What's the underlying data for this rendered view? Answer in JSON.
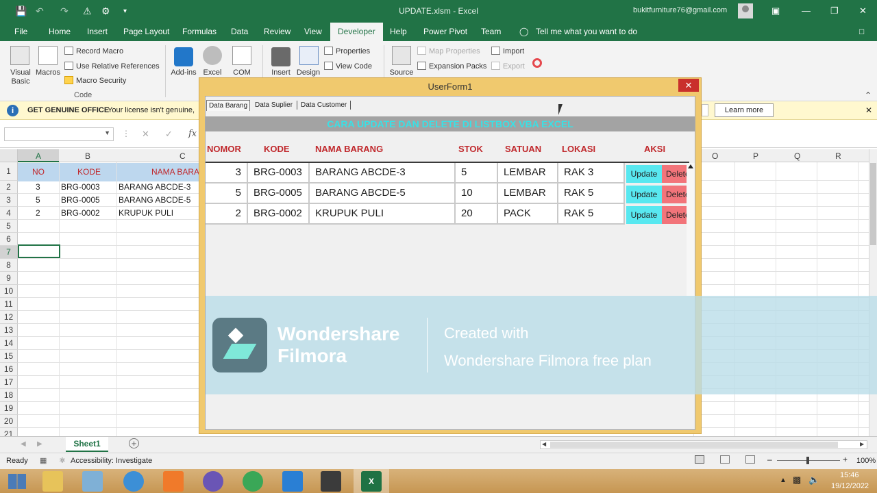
{
  "window": {
    "title": "UPDATE.xlsm  -  Excel",
    "account": "bukitfurniture76@gmail.com"
  },
  "tabs": [
    "File",
    "Home",
    "Insert",
    "Page Layout",
    "Formulas",
    "Data",
    "Review",
    "View",
    "Developer",
    "Help",
    "Power Pivot",
    "Team"
  ],
  "active_tab": "Developer",
  "tell_me": "Tell me what you want to do",
  "ribbon": {
    "visual_basic": "Visual Basic",
    "macros": "Macros",
    "record_macro": "Record Macro",
    "relative_refs": "Use Relative References",
    "macro_security": "Macro Security",
    "code_group": "Code",
    "addins": "Add-ins",
    "excel": "Excel",
    "com": "COM",
    "insert": "Insert",
    "design": "Design",
    "properties": "Properties",
    "view_code": "View Code",
    "source": "Source",
    "map_properties": "Map Properties",
    "expansion_packs": "Expansion Packs",
    "import": "Import",
    "export": "Export"
  },
  "license_bar": {
    "title": "GET GENUINE OFFICE",
    "message": "Your license isn't genuine,",
    "learn_more": "Learn more"
  },
  "grid": {
    "columns_left": [
      "A",
      "B",
      "C"
    ],
    "columns_right": [
      "O",
      "P",
      "Q",
      "R"
    ],
    "rows": [
      "1",
      "2",
      "3",
      "4",
      "5",
      "6",
      "7",
      "8",
      "9",
      "10",
      "11",
      "12",
      "13",
      "14",
      "15",
      "16",
      "17",
      "18",
      "19",
      "20",
      "21"
    ],
    "header_row": [
      "NO",
      "KODE",
      "NAMA BARA"
    ],
    "data": [
      [
        "3",
        "BRG-0003",
        "BARANG ABCDE-3"
      ],
      [
        "5",
        "BRG-0005",
        "BARANG ABCDE-5"
      ],
      [
        "2",
        "BRG-0002",
        "KRUPUK PULI"
      ]
    ]
  },
  "sheet_tab": "Sheet1",
  "status": {
    "ready": "Ready",
    "accessibility": "Accessibility: Investigate",
    "zoom": "100%"
  },
  "clock": {
    "time": "15:46",
    "date": "19/12/2022"
  },
  "userform": {
    "caption": "UserForm1",
    "tabs": [
      "Data Barang",
      "Data Suplier",
      "Data Customer"
    ],
    "banner": "CARA UPDATE DAN DELETE DI LISTBOX VBA EXCEL",
    "headers": [
      "NOMOR",
      "KODE",
      "NAMA BARANG",
      "STOK",
      "SATUAN",
      "LOKASI",
      "AKSI"
    ],
    "rows": [
      {
        "nomor": "3",
        "kode": "BRG-0003",
        "nama": "BARANG ABCDE-3",
        "stok": "5",
        "satuan": "LEMBAR",
        "lokasi": "RAK 3"
      },
      {
        "nomor": "5",
        "kode": "BRG-0005",
        "nama": "BARANG ABCDE-5",
        "stok": "10",
        "satuan": "LEMBAR",
        "lokasi": "RAK 5"
      },
      {
        "nomor": "2",
        "kode": "BRG-0002",
        "nama": "KRUPUK PULI",
        "stok": "20",
        "satuan": "PACK",
        "lokasi": "RAK 5"
      }
    ],
    "update_label": "Update",
    "delete_label": "Delete"
  },
  "watermark": {
    "brand1": "Wondershare",
    "brand2": "Filmora",
    "line1": "Created with",
    "line2": "Wondershare Filmora free plan"
  },
  "colors": {
    "excel_green": "#217346",
    "banner_text": "#39e1e6",
    "header_red": "#c0282c",
    "update_btn": "#58e8f0",
    "delete_btn": "#f2747a"
  }
}
